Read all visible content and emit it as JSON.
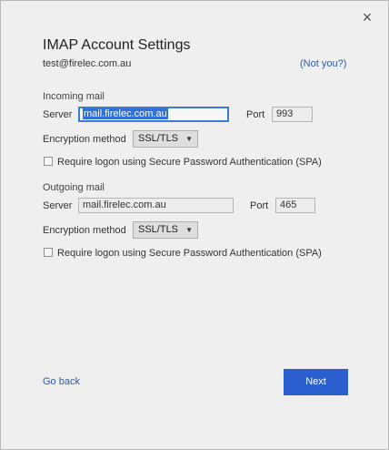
{
  "dialog": {
    "close_icon": "×",
    "title": "IMAP Account Settings",
    "email": "test@firelec.com.au",
    "not_you": "(Not you?)"
  },
  "incoming": {
    "section_label": "Incoming mail",
    "server_label": "Server",
    "server_value": "mail.firelec.com.au",
    "port_label": "Port",
    "port_value": "993",
    "encryption_label": "Encryption method",
    "encryption_value": "SSL/TLS",
    "spa_label": "Require logon using Secure Password Authentication (SPA)",
    "spa_checked": false
  },
  "outgoing": {
    "section_label": "Outgoing mail",
    "server_label": "Server",
    "server_value": "mail.firelec.com.au",
    "port_label": "Port",
    "port_value": "465",
    "encryption_label": "Encryption method",
    "encryption_value": "SSL/TLS",
    "spa_label": "Require logon using Secure Password Authentication (SPA)",
    "spa_checked": false
  },
  "footer": {
    "go_back": "Go back",
    "next": "Next"
  },
  "colors": {
    "accent": "#2b5fd0",
    "link": "#2e5aa8",
    "focus_border": "#3a7bd5",
    "selection": "#2f70d8"
  },
  "icons": {
    "close": "close-icon",
    "dropdown": "chevron-down-icon"
  }
}
